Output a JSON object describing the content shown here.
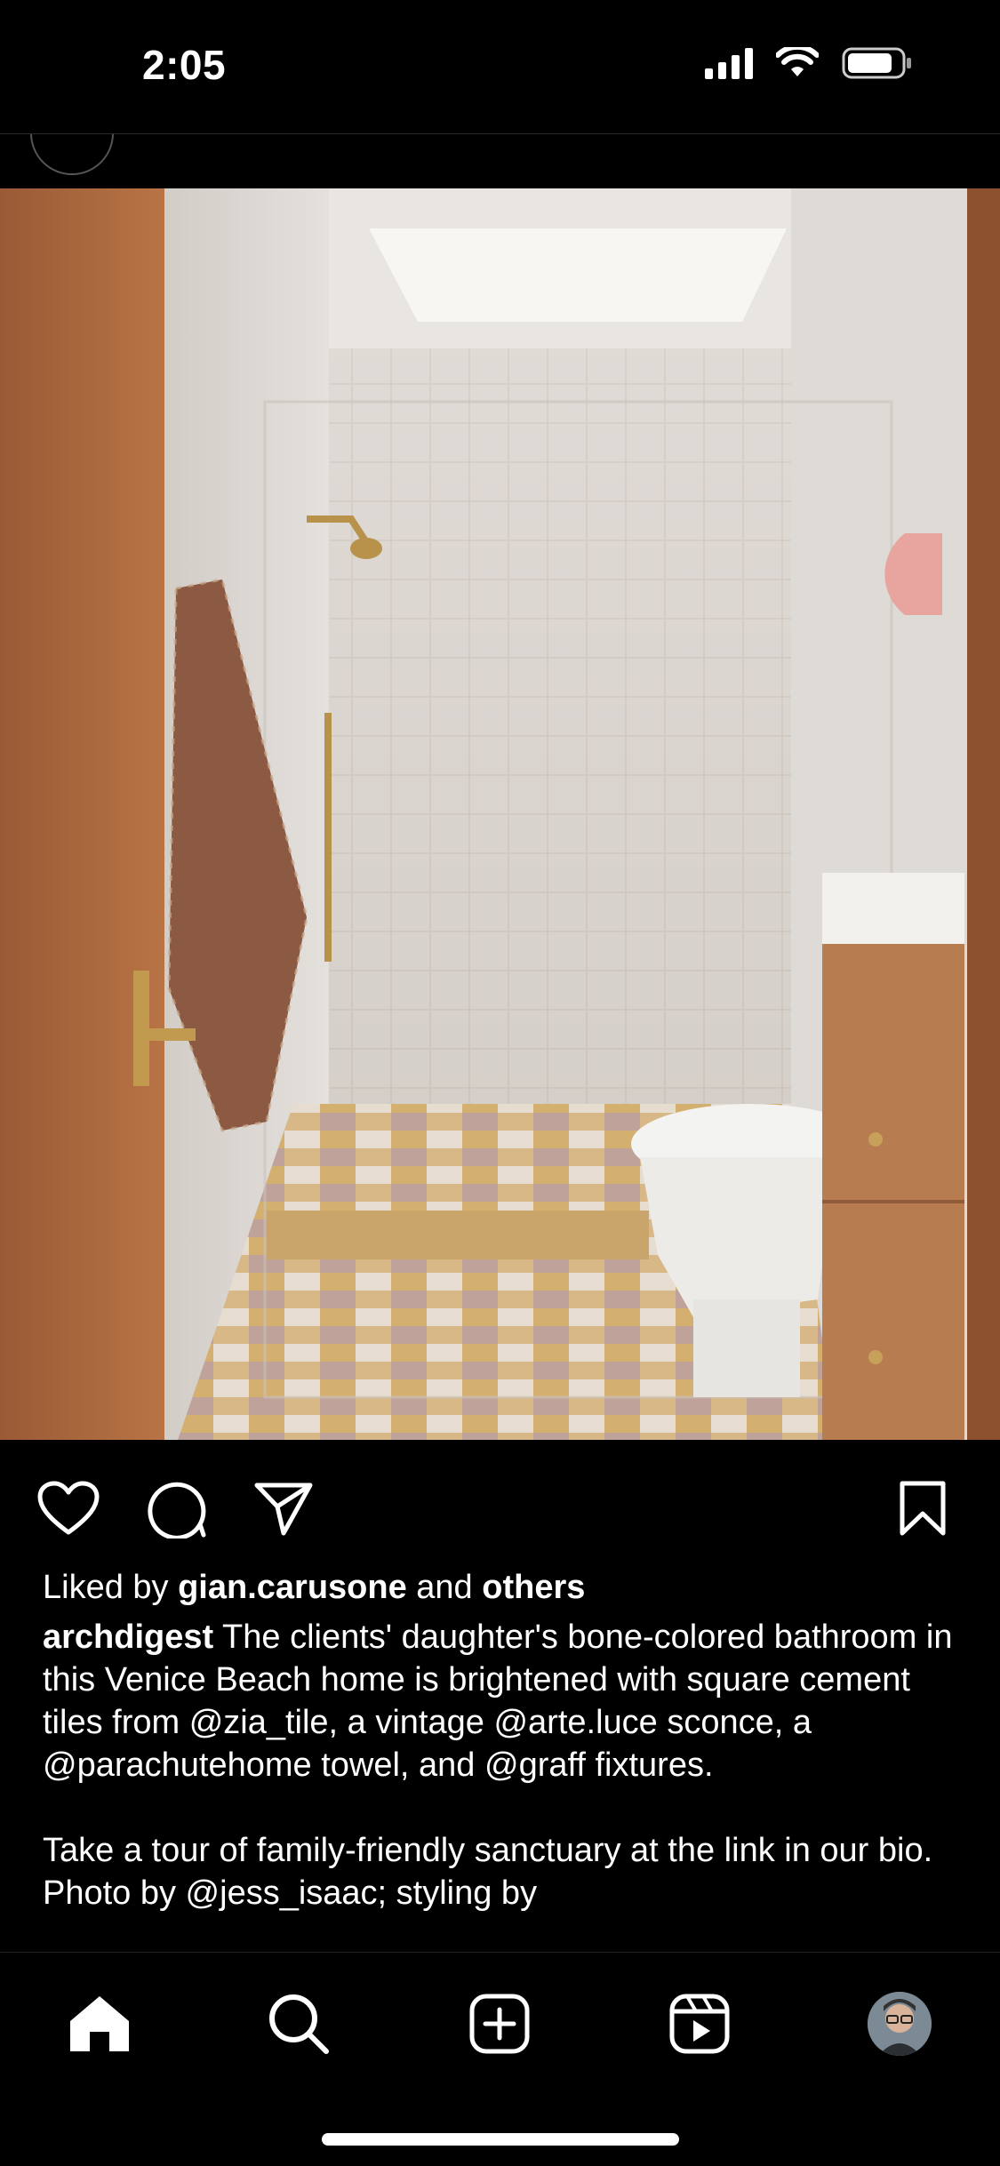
{
  "status_bar": {
    "time": "2:05",
    "battery_level": 0.85
  },
  "post": {
    "liked_by_prefix": "Liked by ",
    "liked_by_user": "gian.carusone",
    "liked_by_and": " and ",
    "liked_by_others": "others",
    "author": "archdigest",
    "caption_1": " The clients' daughter's bone-colored bathroom in this Venice Beach home is brightened with square cement tiles from @zia_tile, a vintage @arte.luce sconce, a @parachutehome towel, and @graff fixtures.",
    "caption_2": "Take a tour of family-friendly sanctuary at the link in our bio. Photo by @jess_isaac; styling by"
  },
  "icons": {
    "like": "heart-icon",
    "comment": "comment-icon",
    "share": "paper-plane-icon",
    "save": "bookmark-icon",
    "home": "home-icon",
    "search": "search-icon",
    "create": "plus-square-icon",
    "reels": "reels-icon",
    "profile": "profile-avatar"
  },
  "colors": {
    "background": "#000000",
    "text": "#ffffff"
  }
}
